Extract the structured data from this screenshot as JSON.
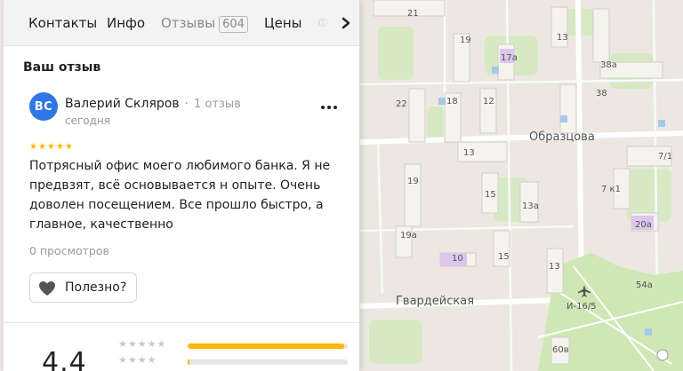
{
  "tabs": [
    {
      "label": "Контакты"
    },
    {
      "label": "Инфо"
    },
    {
      "label": "Отзывы",
      "badge": "604",
      "active": true
    },
    {
      "label": "Цены"
    },
    {
      "label": "Фо"
    }
  ],
  "review_section": {
    "title": "Ваш отзыв"
  },
  "review": {
    "avatar_initials": "ВС",
    "avatar_color": "#2f76e6",
    "author": "Валерий Скляров",
    "author_reviews": "1 отзыв",
    "date": "сегодня",
    "stars": "★★★★★",
    "text": "Потрясный офис моего любимого банка. Я не предвзят, всё основывается н опыте. Очень доволен посещением. Все прошло быстро, а главное, качественно",
    "views": "0 просмотров",
    "useful_label": "Полезно?"
  },
  "rating": {
    "value": "4.4",
    "distribution": [
      {
        "stars": "★★★★★",
        "fraction": 0.98
      },
      {
        "stars": "★★★★",
        "fraction": 0.01
      }
    ]
  },
  "map": {
    "streets": [
      "Образцова",
      "Гвардейская"
    ],
    "labels": [
      "21",
      "19",
      "17а",
      "13",
      "38а",
      "22",
      "18",
      "12",
      "13",
      "7/1",
      "19",
      "15",
      "13а",
      "7 к1",
      "19а",
      "10",
      "15",
      "20а",
      "13",
      "54а",
      "И-16/5",
      "60в",
      "38"
    ]
  },
  "colors": {
    "accent_star": "#ffb800",
    "avatar": "#2f76e6",
    "park": "#cfe7b4"
  }
}
